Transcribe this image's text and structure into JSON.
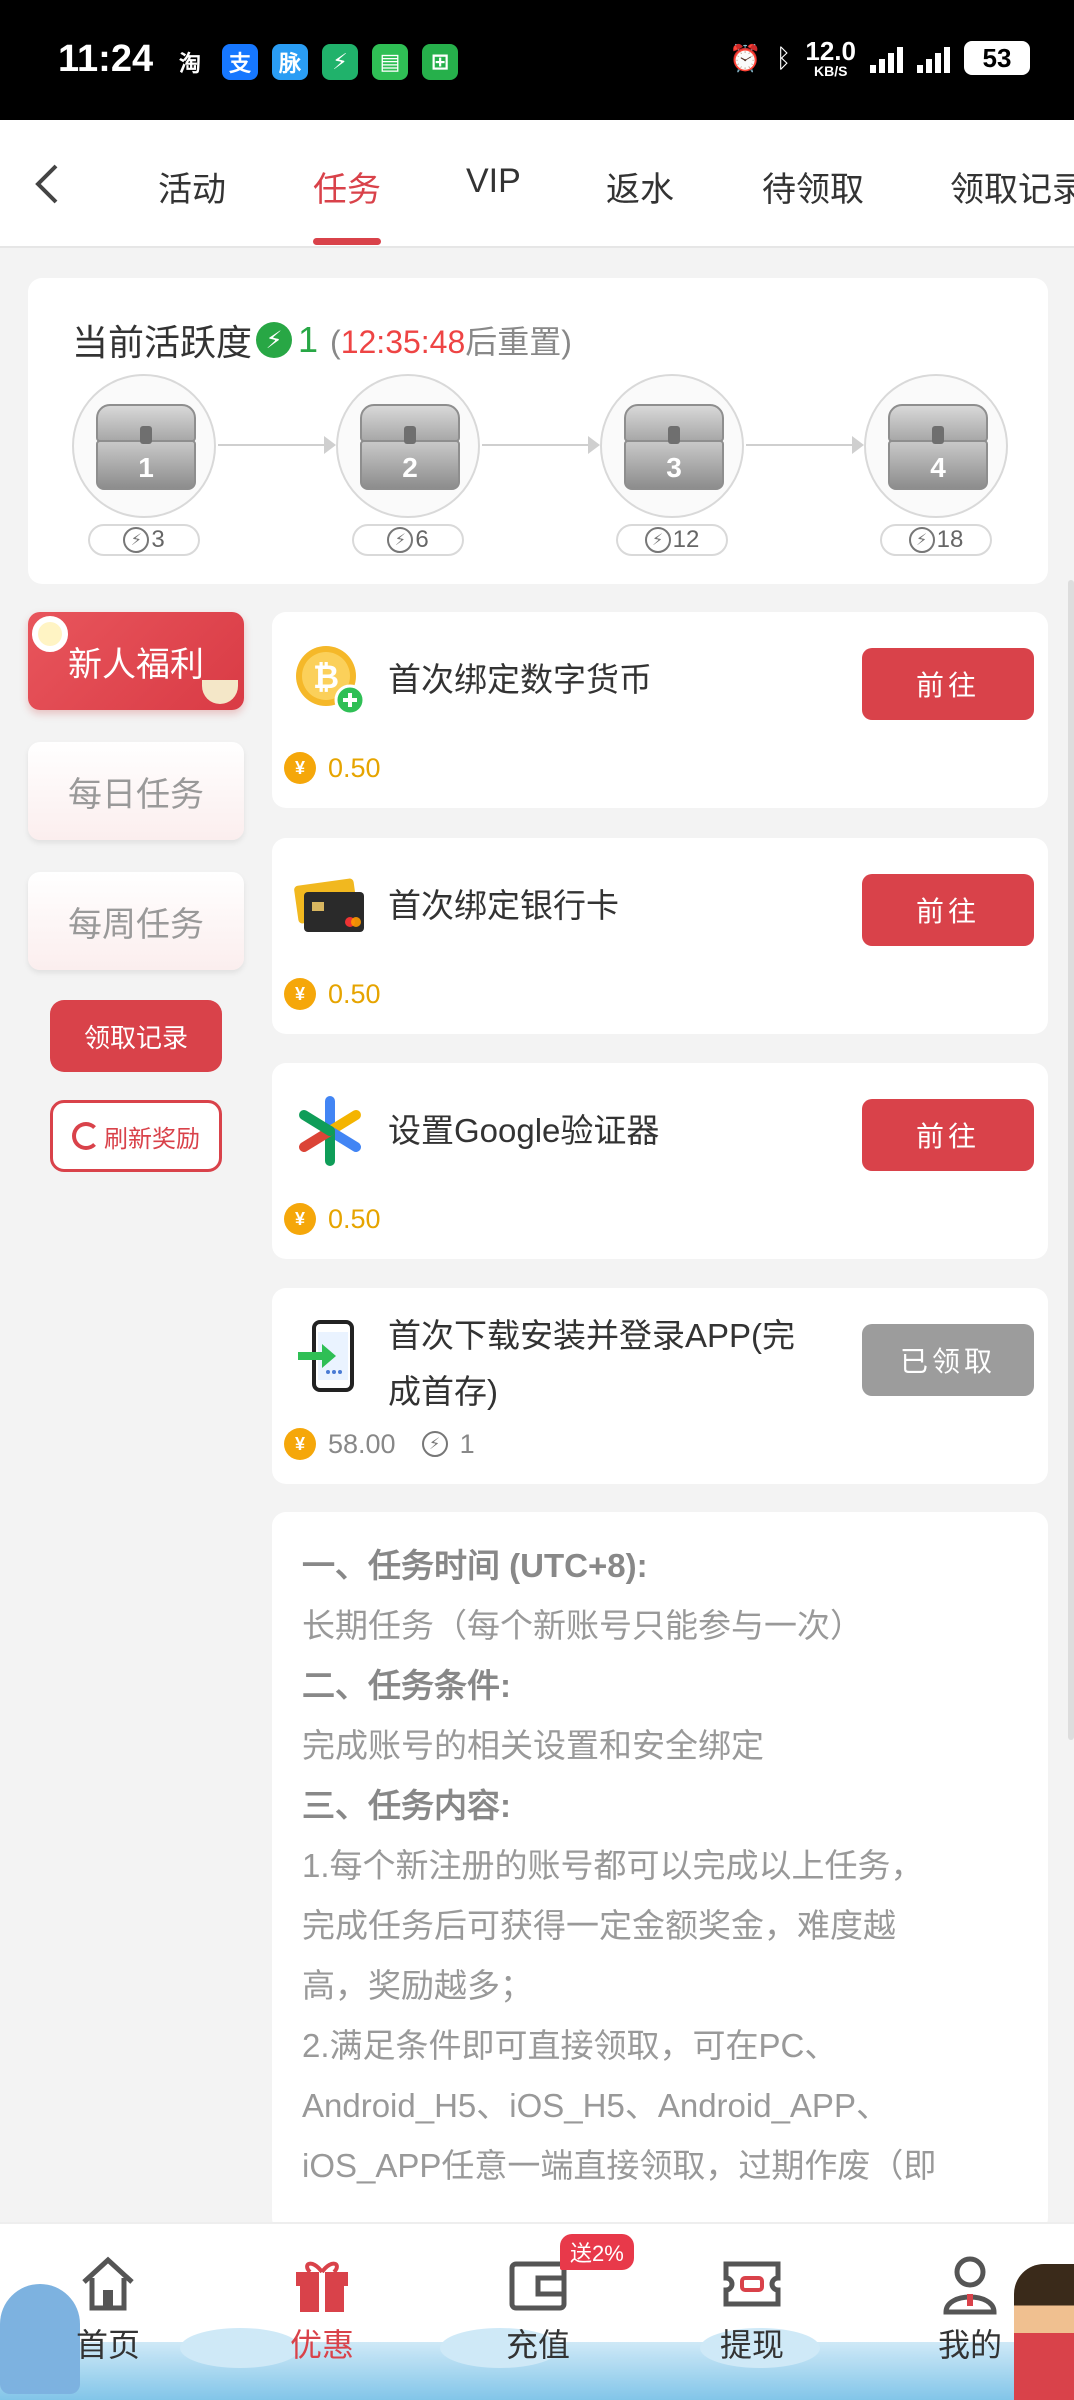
{
  "status_bar": {
    "time": "11:24",
    "apps": [
      {
        "glyph": "淘",
        "color": "#000000"
      },
      {
        "glyph": "支",
        "color": "#1677ff"
      },
      {
        "glyph": "脉",
        "color": "#2a9df4"
      },
      {
        "glyph": "⚡",
        "color": "#20b26b"
      },
      {
        "glyph": "▤",
        "color": "#2fbf55"
      },
      {
        "glyph": "⊞",
        "color": "#26b04b"
      }
    ],
    "speed_value": "12.0",
    "speed_unit": "KB/S",
    "battery": "53"
  },
  "topnav": {
    "back_icon": "chevron-left-icon",
    "tabs": [
      "活动",
      "任务",
      "VIP",
      "返水",
      "待领取",
      "领取记录"
    ],
    "active_tab": "任务"
  },
  "activity": {
    "label": "当前活跃度",
    "value": "1",
    "paren_open": "(",
    "countdown": "12:35:48",
    "reset_suffix": "后重置)",
    "chests": [
      {
        "num": "1",
        "required": "3"
      },
      {
        "num": "2",
        "required": "6"
      },
      {
        "num": "3",
        "required": "12"
      },
      {
        "num": "4",
        "required": "18"
      }
    ]
  },
  "side_menu": {
    "items": [
      "新人福利",
      "每日任务",
      "每周任务"
    ],
    "active": "新人福利",
    "record_button": "领取记录",
    "refresh_button": "刷新奖励"
  },
  "tasks": [
    {
      "icon": "bitcoin-icon",
      "title_lines": [
        "首次绑定数字货币"
      ],
      "button": "前往",
      "status": "go",
      "reward": "0.50",
      "activity": ""
    },
    {
      "icon": "bank-card-icon",
      "title_lines": [
        "首次绑定银行卡"
      ],
      "button": "前往",
      "status": "go",
      "reward": "0.50",
      "activity": ""
    },
    {
      "icon": "google-authenticator-icon",
      "title_lines": [
        "设置Google验证器"
      ],
      "button": "前往",
      "status": "go",
      "reward": "0.50",
      "activity": ""
    },
    {
      "icon": "phone-download-icon",
      "title_lines": [
        "首次下载安装并登录APP(完",
        "成首存)"
      ],
      "button": "已领取",
      "status": "done",
      "reward": "58.00",
      "activity": "1"
    }
  ],
  "description": {
    "lines": [
      {
        "text": "一、任务时间 (UTC+8):",
        "heading": true
      },
      {
        "text": "长期任务（每个新账号只能参与一次）",
        "heading": false
      },
      {
        "text": "二、任务条件:",
        "heading": true
      },
      {
        "text": "完成账号的相关设置和安全绑定",
        "heading": false
      },
      {
        "text": "三、任务内容:",
        "heading": true
      },
      {
        "text": "1.每个新注册的账号都可以完成以上任务，",
        "heading": false
      },
      {
        "text": "完成任务后可获得一定金额奖金，难度越",
        "heading": false
      },
      {
        "text": "高，奖励越多；",
        "heading": false
      },
      {
        "text": "2.满足条件即可直接领取，可在PC、",
        "heading": false
      },
      {
        "text": "Android_H5、iOS_H5、Android_APP、",
        "heading": false
      },
      {
        "text": "iOS_APP任意一端直接领取，过期作废（即",
        "heading": false
      }
    ]
  },
  "bottom_nav": {
    "items": [
      {
        "label": "首页",
        "icon": "home-icon"
      },
      {
        "label": "优惠",
        "icon": "gift-icon"
      },
      {
        "label": "充值",
        "icon": "wallet-icon"
      },
      {
        "label": "提现",
        "icon": "ticket-icon"
      },
      {
        "label": "我的",
        "icon": "user-icon"
      }
    ],
    "active": "优惠",
    "promo_badge": "送2%"
  },
  "colors": {
    "accent": "#d9424a",
    "green": "#28a745",
    "gold": "#f5a70a"
  }
}
